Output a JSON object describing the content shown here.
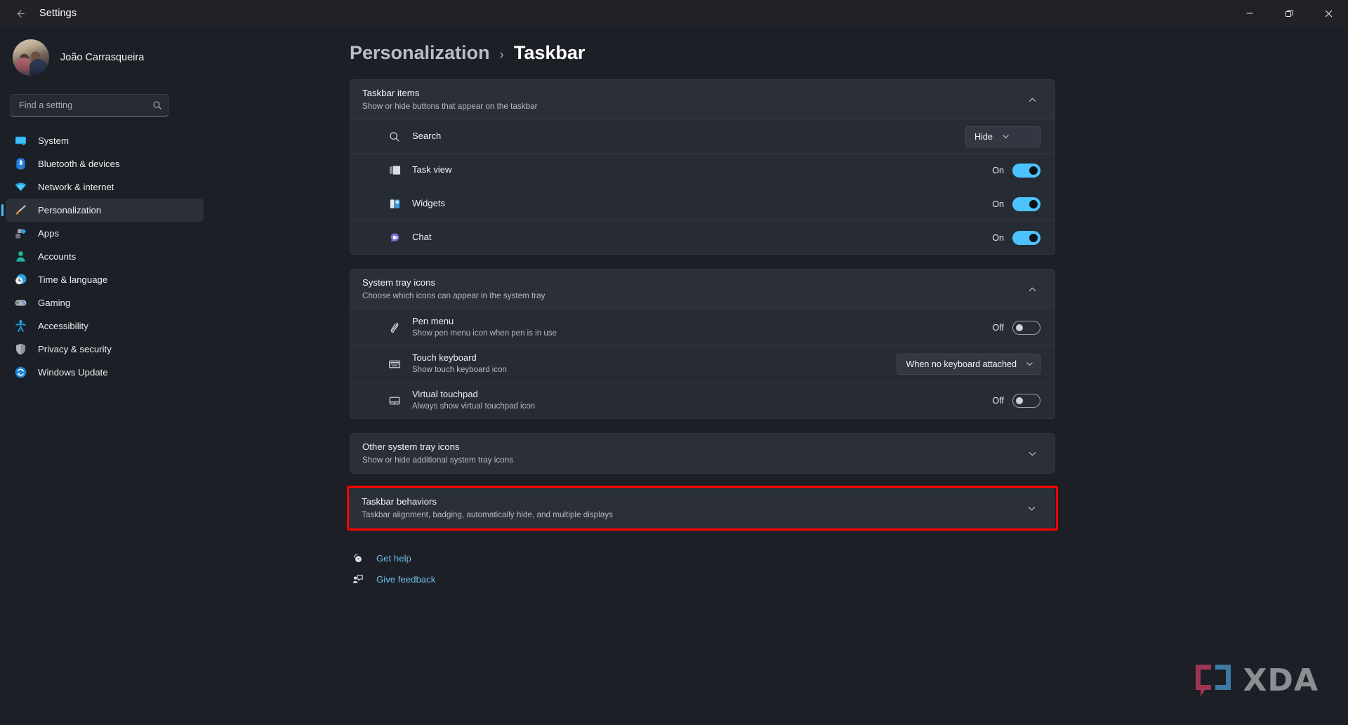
{
  "titlebar": {
    "back_label": "back-arrow",
    "app_title": "Settings",
    "minimize": "─",
    "maximize": "❐",
    "close": "✕"
  },
  "sidebar": {
    "profile_name": "João Carrasqueira",
    "search": {
      "placeholder": "Find a setting",
      "value": ""
    },
    "items": [
      {
        "label": "System",
        "icon": "monitor-icon",
        "active": false
      },
      {
        "label": "Bluetooth & devices",
        "icon": "bluetooth-icon",
        "active": false
      },
      {
        "label": "Network & internet",
        "icon": "wifi-icon",
        "active": false
      },
      {
        "label": "Personalization",
        "icon": "brush-icon",
        "active": true
      },
      {
        "label": "Apps",
        "icon": "apps-icon",
        "active": false
      },
      {
        "label": "Accounts",
        "icon": "person-icon",
        "active": false
      },
      {
        "label": "Time & language",
        "icon": "clock-icon",
        "active": false
      },
      {
        "label": "Gaming",
        "icon": "gamepad-icon",
        "active": false
      },
      {
        "label": "Accessibility",
        "icon": "accessibility-icon",
        "active": false
      },
      {
        "label": "Privacy & security",
        "icon": "shield-icon",
        "active": false
      },
      {
        "label": "Windows Update",
        "icon": "update-icon",
        "active": false
      }
    ]
  },
  "breadcrumb": {
    "parent": "Personalization",
    "separator": "›",
    "current": "Taskbar"
  },
  "sections": {
    "taskbar_items": {
      "title": "Taskbar items",
      "subtitle": "Show or hide buttons that appear on the taskbar",
      "expanded": true,
      "chevron": "chevron-up-icon",
      "rows": {
        "search": {
          "label": "Search",
          "icon": "search-icon",
          "control": "dropdown",
          "value": "Hide"
        },
        "task_view": {
          "label": "Task view",
          "icon": "taskview-icon",
          "control": "toggle",
          "state": "On"
        },
        "widgets": {
          "label": "Widgets",
          "icon": "widgets-icon",
          "control": "toggle",
          "state": "On"
        },
        "chat": {
          "label": "Chat",
          "icon": "chat-icon",
          "control": "toggle",
          "state": "On"
        }
      }
    },
    "system_tray_icons": {
      "title": "System tray icons",
      "subtitle": "Choose which icons can appear in the system tray",
      "expanded": true,
      "chevron": "chevron-up-icon",
      "rows": {
        "pen_menu": {
          "label": "Pen menu",
          "subtitle": "Show pen menu icon when pen is in use",
          "icon": "pen-icon",
          "control": "toggle",
          "state": "Off"
        },
        "touch_keyboard": {
          "label": "Touch keyboard",
          "subtitle": "Show touch keyboard icon",
          "icon": "keyboard-icon",
          "control": "dropdown",
          "value": "When no keyboard attached"
        },
        "virtual_touchpad": {
          "label": "Virtual touchpad",
          "subtitle": "Always show virtual touchpad icon",
          "icon": "touchpad-icon",
          "control": "toggle",
          "state": "Off"
        }
      }
    },
    "other_system_tray_icons": {
      "title": "Other system tray icons",
      "subtitle": "Show or hide additional system tray icons",
      "expanded": false,
      "chevron": "chevron-down-icon"
    },
    "taskbar_behaviors": {
      "title": "Taskbar behaviors",
      "subtitle": "Taskbar alignment, badging, automatically hide, and multiple displays",
      "expanded": false,
      "chevron": "chevron-down-icon",
      "highlighted": true,
      "highlight_color": "#ff0000"
    }
  },
  "footer_links": [
    {
      "label": "Get help",
      "icon": "help-icon"
    },
    {
      "label": "Give feedback",
      "icon": "feedback-icon"
    }
  ],
  "watermark": {
    "text": "XDA",
    "bracket_left_color": "#9e3552",
    "bracket_right_color": "#3d7ba6",
    "text_color": "#8b8e93"
  },
  "colors": {
    "accent": "#4cc2ff",
    "link": "#6fbde8",
    "card_bg": "#272b33",
    "section_bg": "#2b2f38",
    "window_bg": "#1c1f26"
  }
}
